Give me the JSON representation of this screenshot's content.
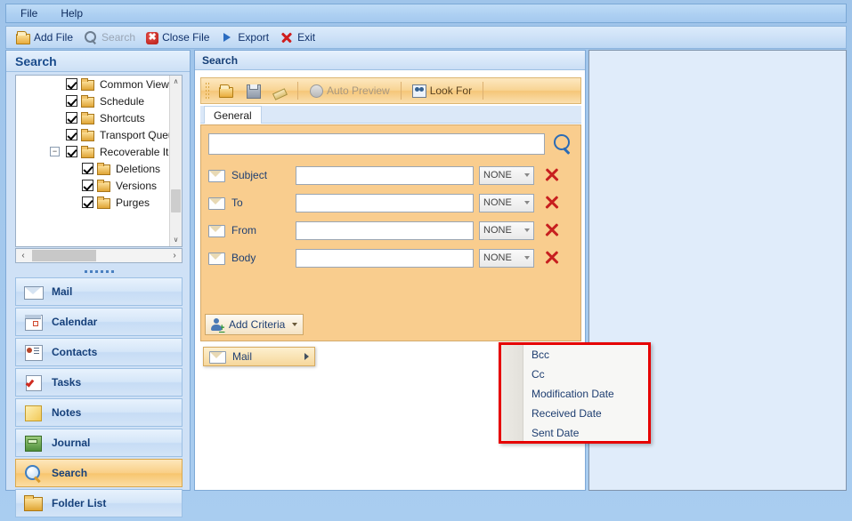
{
  "menubar": {
    "items": [
      {
        "label": "File"
      },
      {
        "label": "Help"
      }
    ]
  },
  "toolbar": {
    "items": [
      {
        "label": "Add File",
        "icon": "folder-open-icon",
        "enabled": true
      },
      {
        "label": "Search",
        "icon": "search-icon",
        "enabled": false
      },
      {
        "label": "Close File",
        "icon": "close-file-icon",
        "enabled": true
      },
      {
        "label": "Export",
        "icon": "export-icon",
        "enabled": true
      },
      {
        "label": "Exit",
        "icon": "exit-icon",
        "enabled": true
      }
    ],
    "close_file_glyph": "✖"
  },
  "left_pane": {
    "title": "Search",
    "tree": [
      {
        "label": "Common Views",
        "level": 1,
        "checked": true,
        "expander": null
      },
      {
        "label": "Schedule",
        "level": 1,
        "checked": true,
        "expander": null
      },
      {
        "label": "Shortcuts",
        "level": 1,
        "checked": true,
        "expander": null
      },
      {
        "label": "Transport Queue",
        "level": 1,
        "checked": true,
        "expander": null
      },
      {
        "label": "Recoverable Item",
        "level": 1,
        "checked": true,
        "expander": "−"
      },
      {
        "label": "Deletions",
        "level": 2,
        "checked": true,
        "expander": null
      },
      {
        "label": "Versions",
        "level": 2,
        "checked": true,
        "expander": null
      },
      {
        "label": "Purges",
        "level": 2,
        "checked": true,
        "expander": null
      }
    ],
    "scroll": {
      "up": "∧",
      "down": "∨",
      "left": "‹",
      "right": "›"
    },
    "nav_items": [
      {
        "label": "Mail",
        "icon": "mail-icon",
        "active": false
      },
      {
        "label": "Calendar",
        "icon": "calendar-icon",
        "active": false
      },
      {
        "label": "Contacts",
        "icon": "contacts-icon",
        "active": false
      },
      {
        "label": "Tasks",
        "icon": "tasks-icon",
        "active": false
      },
      {
        "label": "Notes",
        "icon": "notes-icon",
        "active": false
      },
      {
        "label": "Journal",
        "icon": "journal-icon",
        "active": false
      },
      {
        "label": "Search",
        "icon": "search-icon",
        "active": true
      },
      {
        "label": "Folder List",
        "icon": "folder-list-icon",
        "active": false
      }
    ]
  },
  "center_pane": {
    "title": "Search",
    "toolbar": {
      "open_label": "",
      "save_label": "",
      "erase_label": "",
      "auto_preview_label": "Auto Preview",
      "look_for_label": "Look For"
    },
    "tabs": [
      {
        "label": "General",
        "active": true
      }
    ],
    "search_box": {
      "value": "",
      "placeholder": ""
    },
    "criteria_rows": [
      {
        "label": "Subject",
        "value": "",
        "condition": "NONE"
      },
      {
        "label": "To",
        "value": "",
        "condition": "NONE"
      },
      {
        "label": "From",
        "value": "",
        "condition": "NONE"
      },
      {
        "label": "Body",
        "value": "",
        "condition": "NONE"
      }
    ],
    "add_criteria_label": "Add Criteria",
    "submenu": {
      "label": "Mail",
      "items": [
        {
          "label": "Bcc"
        },
        {
          "label": "Cc"
        },
        {
          "label": "Modification Date"
        },
        {
          "label": "Received Date"
        },
        {
          "label": "Sent Date"
        }
      ]
    }
  },
  "colors": {
    "accent_orange": "#f9cd8e",
    "window_blue": "#a9cdf0",
    "highlight_red": "#e60000",
    "label_blue": "#1e3f72"
  }
}
